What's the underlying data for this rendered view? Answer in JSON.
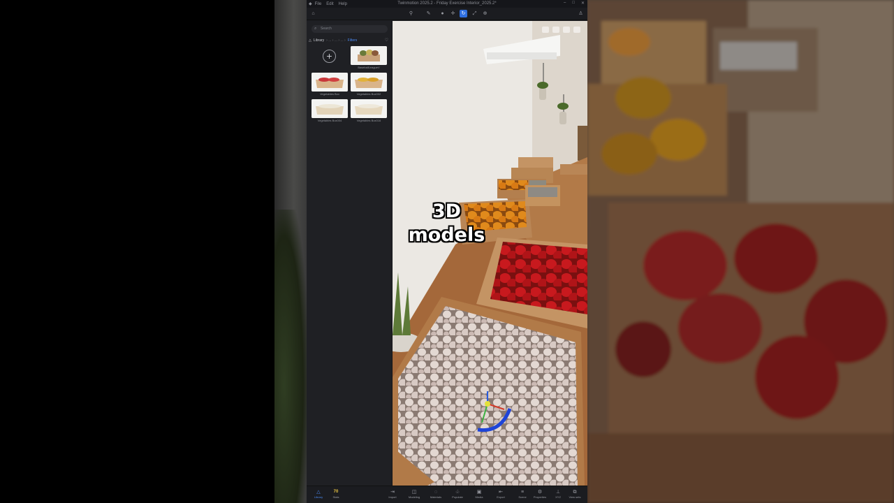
{
  "titlebar": {
    "menu": [
      "File",
      "Edit",
      "Help"
    ],
    "title": "Twinmotion 2025.2 - Friday Exercise Interior_2025.2*"
  },
  "sidebar": {
    "search_placeholder": "Search",
    "library_label": "Library",
    "breadcrumb": "› ... › ... › ... ›",
    "filters_label": "Filters",
    "items": [
      {
        "label": "BaseballLeagueV"
      },
      {
        "label": "Vegetables Box"
      },
      {
        "label": "Vegetables Box002"
      },
      {
        "label": "Vegetables Box004"
      },
      {
        "label": "Vegetables Box016"
      }
    ]
  },
  "overlay": {
    "caption_line1": "3D",
    "caption_line2": "models"
  },
  "bottombar": {
    "items": [
      {
        "label": "Library",
        "icon": "library-icon"
      },
      {
        "label": "Stats",
        "value": "70"
      },
      {
        "label": "Import",
        "icon": "import-icon"
      },
      {
        "label": "Modeling",
        "icon": "modeling-icon"
      },
      {
        "label": "Materials",
        "icon": "materials-icon"
      },
      {
        "label": "Populate",
        "icon": "populate-icon"
      },
      {
        "label": "Media",
        "icon": "media-icon"
      },
      {
        "label": "Export",
        "icon": "export-icon"
      },
      {
        "label": "Scene",
        "icon": "scene-icon"
      },
      {
        "label": "Properties",
        "icon": "properties-icon"
      },
      {
        "label": "XYZ",
        "icon": "xyz-icon"
      },
      {
        "label": "View sets",
        "icon": "view-sets-icon"
      }
    ]
  },
  "colors": {
    "accent": "#2f6fe0",
    "panel": "#1e1f23",
    "stats": "#e8c443"
  }
}
